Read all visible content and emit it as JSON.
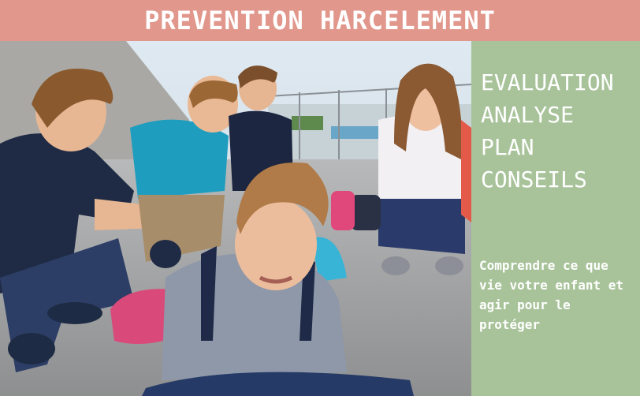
{
  "header": {
    "title": "PREVENTION HARCELEMENT"
  },
  "panel": {
    "topics": [
      "EVALUATION",
      "ANALYSE",
      "PLAN",
      "CONSEILS"
    ],
    "tagline": "Comprendre ce que vie votre enfant et agir pour le protéger"
  },
  "photo": {
    "subject": "schoolyard-bullying-scene-icon"
  },
  "colors": {
    "header_bg": "#e1978b",
    "panel_bg": "#a8c39a",
    "text": "#ffffff"
  }
}
